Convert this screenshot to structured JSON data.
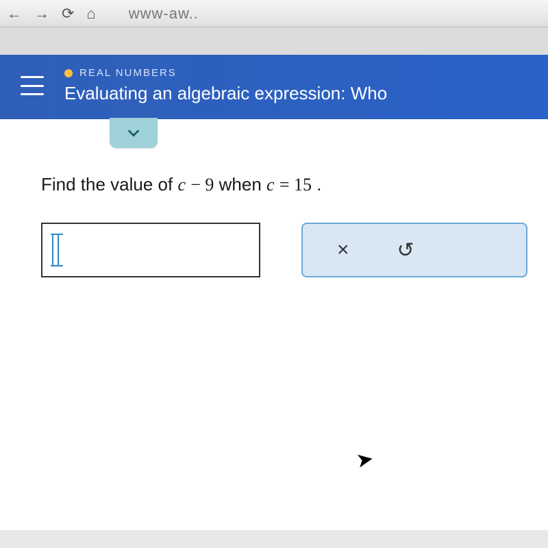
{
  "browser": {
    "url_fragment": "www-aw.."
  },
  "header": {
    "category": "REAL NUMBERS",
    "topic": "Evaluating an algebraic expression: Who"
  },
  "question": {
    "prefix": "Find the value of ",
    "expr_var1": "c",
    "expr_op": " − ",
    "expr_k1": "9",
    "mid": " when ",
    "expr_var2": "c",
    "expr_eq": " = ",
    "expr_k2": "15",
    "suffix": "."
  },
  "answer": {
    "value": ""
  },
  "tools": {
    "clear": "×",
    "undo": "↺"
  }
}
